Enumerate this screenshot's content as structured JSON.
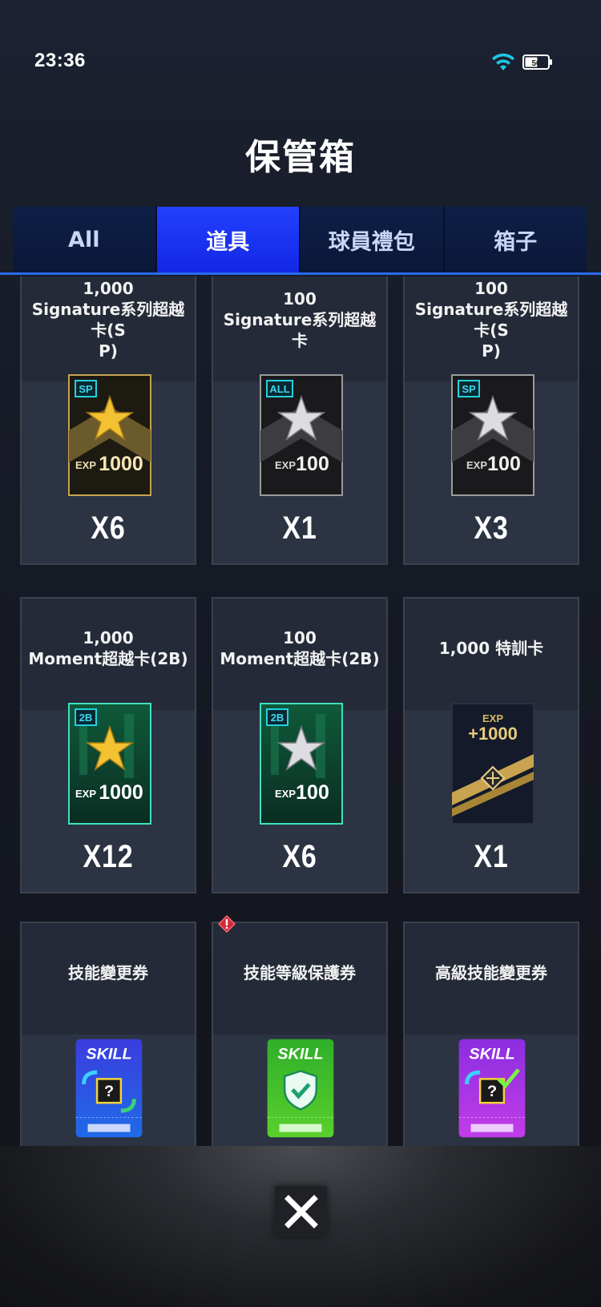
{
  "status_bar": {
    "time": "23:36",
    "battery_level": "56"
  },
  "header": {
    "title": "保管箱"
  },
  "tabs": [
    {
      "label": "All",
      "active": false
    },
    {
      "label": "道具",
      "active": true
    },
    {
      "label": "球員禮包",
      "active": false
    },
    {
      "label": "箱子",
      "active": false
    }
  ],
  "items": [
    {
      "name": "1,000\nSignature系列超越卡(S\nP)",
      "count": "X6",
      "badge": "SP",
      "exp_label": "EXP",
      "exp_value": "1000",
      "style": "gold-star"
    },
    {
      "name": "100\nSignature系列超越卡",
      "count": "X1",
      "badge": "ALL",
      "exp_label": "EXP",
      "exp_value": "100",
      "style": "silver-star"
    },
    {
      "name": "100\nSignature系列超越卡(S\nP)",
      "count": "X3",
      "badge": "SP",
      "exp_label": "EXP",
      "exp_value": "100",
      "style": "silver-star"
    },
    {
      "name": "1,000\nMoment超越卡(2B)",
      "count": "X12",
      "badge": "2B",
      "exp_label": "EXP",
      "exp_value": "1000",
      "style": "green-gold-star"
    },
    {
      "name": "100\nMoment超越卡(2B)",
      "count": "X6",
      "badge": "2B",
      "exp_label": "EXP",
      "exp_value": "100",
      "style": "green-silver-star"
    },
    {
      "name": "1,000 特訓卡",
      "count": "X1",
      "badge": "",
      "exp_label": "EXP",
      "exp_value": "+1000",
      "style": "training"
    },
    {
      "name": "技能變更券",
      "count": "",
      "badge": "SKILL",
      "style": "skill-blue"
    },
    {
      "name": "技能等級保護券",
      "count": "",
      "badge": "SKILL",
      "style": "skill-green",
      "alert": true
    },
    {
      "name": "高級技能變更券",
      "count": "",
      "badge": "SKILL",
      "style": "skill-purple"
    }
  ],
  "colors": {
    "accent": "#1f36f5",
    "tab_bg": "#0c1b40",
    "card_border": "#3a414f"
  },
  "close_icon": "close-x-icon"
}
